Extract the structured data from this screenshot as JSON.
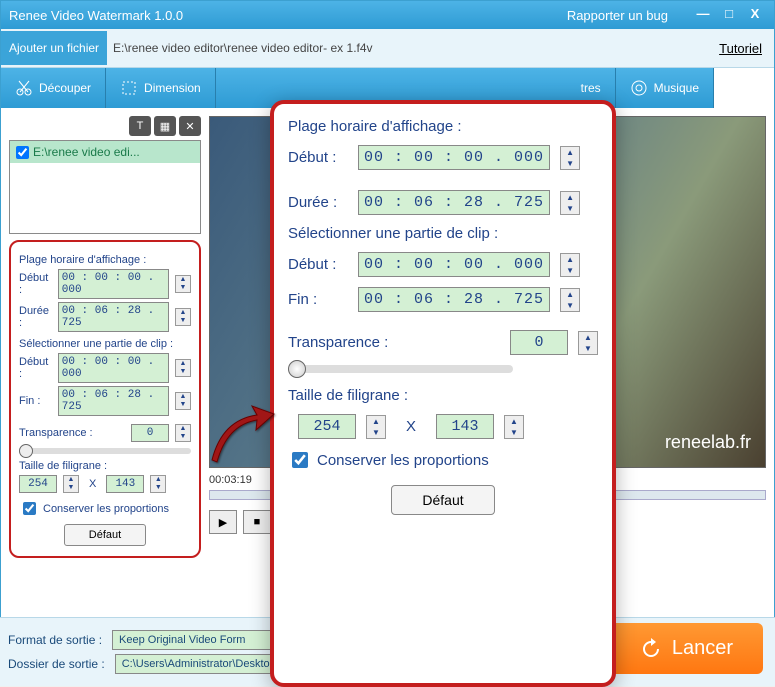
{
  "titlebar": {
    "title": "Renee Video Watermark 1.0.0",
    "bug": "Rapporter un bug"
  },
  "filebar": {
    "add": "Ajouter un fichier",
    "path": "E:\\renee video editor\\renee video editor- ex 1.f4v",
    "tutorial": "Tutoriel"
  },
  "toolbar": {
    "cut": "Découper",
    "dim": "Dimension",
    "filters": "tres",
    "music": "Musique"
  },
  "filelist": {
    "item": "E:\\renee video edi..."
  },
  "panel": {
    "plage": "Plage horaire d'affichage :",
    "debut": "Début :",
    "duree": "Durée :",
    "select": "Sélectionner une partie de clip :",
    "fin": "Fin :",
    "t_debut1": "00 : 00 : 00 . 000",
    "t_duree": "00 : 06 : 28 . 725",
    "t_debut2": "00 : 00 : 00 . 000",
    "t_fin": "00 : 06 : 28 . 725",
    "trans": "Transparence :",
    "trans_v": "0",
    "taille": "Taille de filigrane :",
    "w": "254",
    "x": "X",
    "h": "143",
    "keep": "Conserver les proportions",
    "def": "Défaut"
  },
  "preview": {
    "watermark": "reneelab.fr",
    "time": "00:03:19"
  },
  "bottom": {
    "format_lbl": "Format de sortie :",
    "format_v": "Keep Original Video Form",
    "dest_lbl": "Dossier de sortie :",
    "dest_v": "C:\\Users\\Administrator\\Desktop\\",
    "launch": "Lancer"
  }
}
